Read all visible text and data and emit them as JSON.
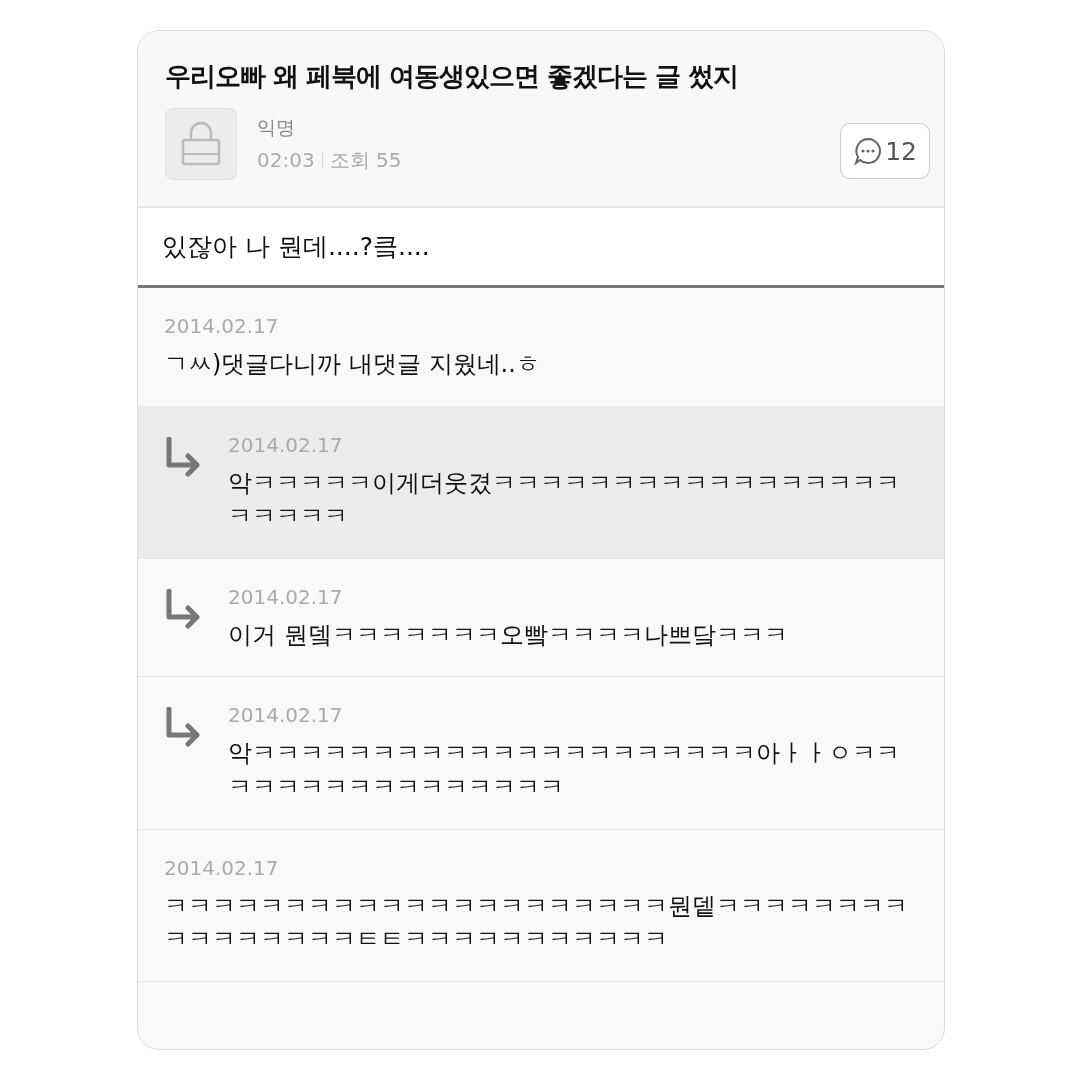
{
  "post": {
    "title": "우리오빠 왜 페북에 여동생있으면 좋겠다는 글 썼지",
    "author": "익명",
    "time": "02:03",
    "views": "조회 55",
    "comment_count": "12",
    "body": "있잖아 나 뭔데....?킄...."
  },
  "comments": [
    {
      "kind": "comment",
      "date": "2014.02.17",
      "text": "ㄱㅆ)댓글다니까 내댓글 지웠네..ㅎ",
      "highlighted": false
    },
    {
      "kind": "reply",
      "date": "2014.02.17",
      "text": "악ㅋㅋㅋㅋㅋ이게더웃겼ㅋㅋㅋㅋㅋㅋㅋㅋㅋㅋㅋㅋㅋㅋㅋㅋㅋㅋㅋㅋㅋㅋ",
      "highlighted": true
    },
    {
      "kind": "reply",
      "date": "2014.02.17",
      "text": "이거 뭔뎈ㅋㅋㅋㅋㅋㅋㅋ오빸ㅋㅋㅋㅋ나쁘닼ㅋㅋㅋ",
      "highlighted": false
    },
    {
      "kind": "reply",
      "date": "2014.02.17",
      "text": "악ㅋㅋㅋㅋㅋㅋㅋㅋㅋㅋㅋㅋㅋㅋㅋㅋㅋㅋㅋㅋㅋ아ㅏㅏㅇㅋㅋㅋㅋㅋㅋㅋㅋㅋㅋㅋㅋㅋㅋㅋㅋ",
      "highlighted": false
    },
    {
      "kind": "comment",
      "date": "2014.02.17",
      "text": "ㅋㅋㅋㅋㅋㅋㅋㅋㅋㅋㅋㅋㅋㅋㅋㅋㅋㅋㅋㅋㅋ뭔뎉ㅋㅋㅋㅋㅋㅋㅋㅋㅋㅋㅋㅋㅋㅋㅋㅋㅌㅌㅋㅋㅋㅋㅋㅋㅋㅋㅋㅋㅋ",
      "highlighted": false
    }
  ]
}
